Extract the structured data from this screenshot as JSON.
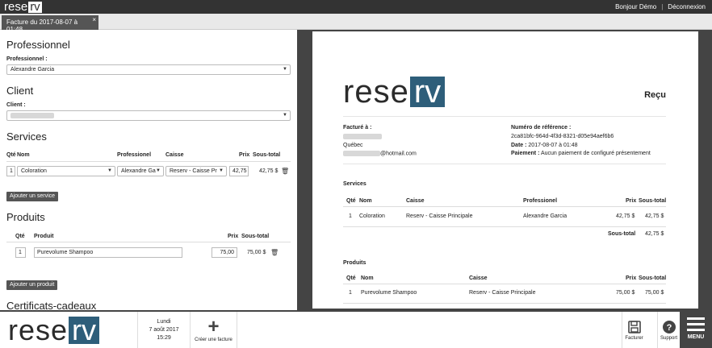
{
  "topbar": {
    "logo_plain": "rese",
    "logo_box": "rv",
    "greeting": "Bonjour Démo",
    "separator": "|",
    "logout": "Déconnexion"
  },
  "tab": {
    "title": "Facture du 2017-08-07 à 01:48",
    "close": "×"
  },
  "form": {
    "pro_section": "Professionnel",
    "pro_label": "Professionnel :",
    "pro_value": "Alexandre Garcia",
    "client_section": "Client",
    "client_label": "Client :",
    "services_section": "Services",
    "services_headers": {
      "qty": "Qté",
      "name": "Nom",
      "pro": "Professionel",
      "caisse": "Caisse",
      "price": "Prix",
      "subtotal": "Sous-total"
    },
    "service_row": {
      "qty": "1",
      "name": "Coloration",
      "pro": "Alexandre Ga",
      "caisse": "Reserv - Caisse Pr",
      "price": "42,75",
      "subtotal": "42,75 $"
    },
    "add_service": "Ajouter un service",
    "products_section": "Produits",
    "products_headers": {
      "qty": "Qté",
      "name": "Produit",
      "price": "Prix",
      "subtotal": "Sous-total"
    },
    "product_row": {
      "qty": "1",
      "name": "Purevolume Shampoo",
      "price": "75,00",
      "subtotal": "75,00 $"
    },
    "add_product": "Ajouter un produit",
    "gift_section": "Certificats-cadeaux"
  },
  "receipt": {
    "logo_plain": "rese",
    "logo_box": "rv",
    "title": "Reçu",
    "billed_to": "Facturé à :",
    "city": "Québec",
    "email_suffix": "@hotmail.com",
    "ref_label": "Numéro de référence :",
    "ref_value": "2ca81bfc-964d-4f3d-8321-d05e94aef6b6",
    "date_label": "Date :",
    "date_value": "2017-08-07 à 01:48",
    "payment_label": "Paiement :",
    "payment_value": "Aucun paiement de configuré présentement",
    "services_title": "Services",
    "services_headers": {
      "qty": "Qté",
      "name": "Nom",
      "caisse": "Caisse",
      "pro": "Professionel",
      "price": "Prix",
      "subtotal": "Sous-total"
    },
    "service_row": {
      "qty": "1",
      "name": "Coloration",
      "caisse": "Reserv - Caisse Principale",
      "pro": "Alexandre Garcia",
      "price": "42,75 $",
      "subtotal": "42,75 $"
    },
    "services_total_label": "Sous-total",
    "services_total_value": "42,75 $",
    "products_title": "Produits",
    "products_headers": {
      "qty": "Qté",
      "name": "Nom",
      "caisse": "Caisse",
      "price": "Prix",
      "subtotal": "Sous-total"
    },
    "product_row": {
      "qty": "1",
      "name": "Purevolume Shampoo",
      "caisse": "Reserv - Caisse Principale",
      "price": "75,00 $",
      "subtotal": "75,00 $"
    }
  },
  "bottombar": {
    "logo_plain": "rese",
    "logo_box": "rv",
    "day": "Lundi",
    "date": "7 août 2017",
    "time": "15:29",
    "new_invoice": "Créer une facture",
    "invoice_btn": "Facturer",
    "support_btn": "Support",
    "menu_btn": "MENU"
  },
  "colors": {
    "brand_dark": "#333333",
    "brand_blue": "#2e5e7a"
  },
  "icons": [
    "close-icon",
    "caret-down-icon",
    "trash-icon",
    "plus-icon",
    "save-icon",
    "help-icon",
    "hamburger-icon"
  ]
}
